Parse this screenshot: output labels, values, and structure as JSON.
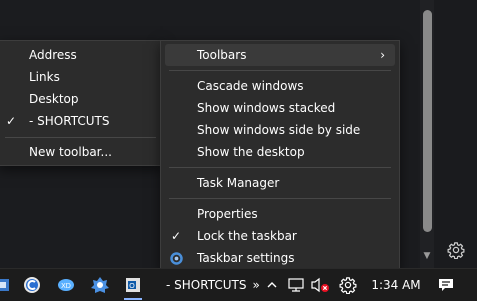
{
  "left_menu": {
    "items": [
      {
        "label": "Address",
        "checked": false
      },
      {
        "label": "Links",
        "checked": false
      },
      {
        "label": "Desktop",
        "checked": false
      },
      {
        "label": "- SHORTCUTS",
        "checked": true
      }
    ],
    "new_toolbar": "New toolbar..."
  },
  "right_menu": {
    "toolbars": "Toolbars",
    "cascade": "Cascade windows",
    "stacked": "Show windows stacked",
    "side_by_side": "Show windows side by side",
    "show_desktop": "Show the desktop",
    "task_manager": "Task Manager",
    "properties": "Properties",
    "lock": "Lock the taskbar",
    "lock_checked": true,
    "taskbar_settings": "Taskbar settings"
  },
  "taskbar": {
    "toolbar_name": "- SHORTCUTS",
    "toolbar_expand": "»",
    "time": "1:34 AM",
    "pinned_icons": [
      "app-icon",
      "ccleaner-icon",
      "web-app-icon",
      "bug-tool-icon",
      "outlook-icon"
    ]
  },
  "colors": {
    "menu_bg": "#2c2c2c",
    "highlight": "#3a3a3a",
    "taskbar_bg": "#1c1c1c",
    "mute_red": "#e81123",
    "settings_blue": "#4a8fd9"
  }
}
